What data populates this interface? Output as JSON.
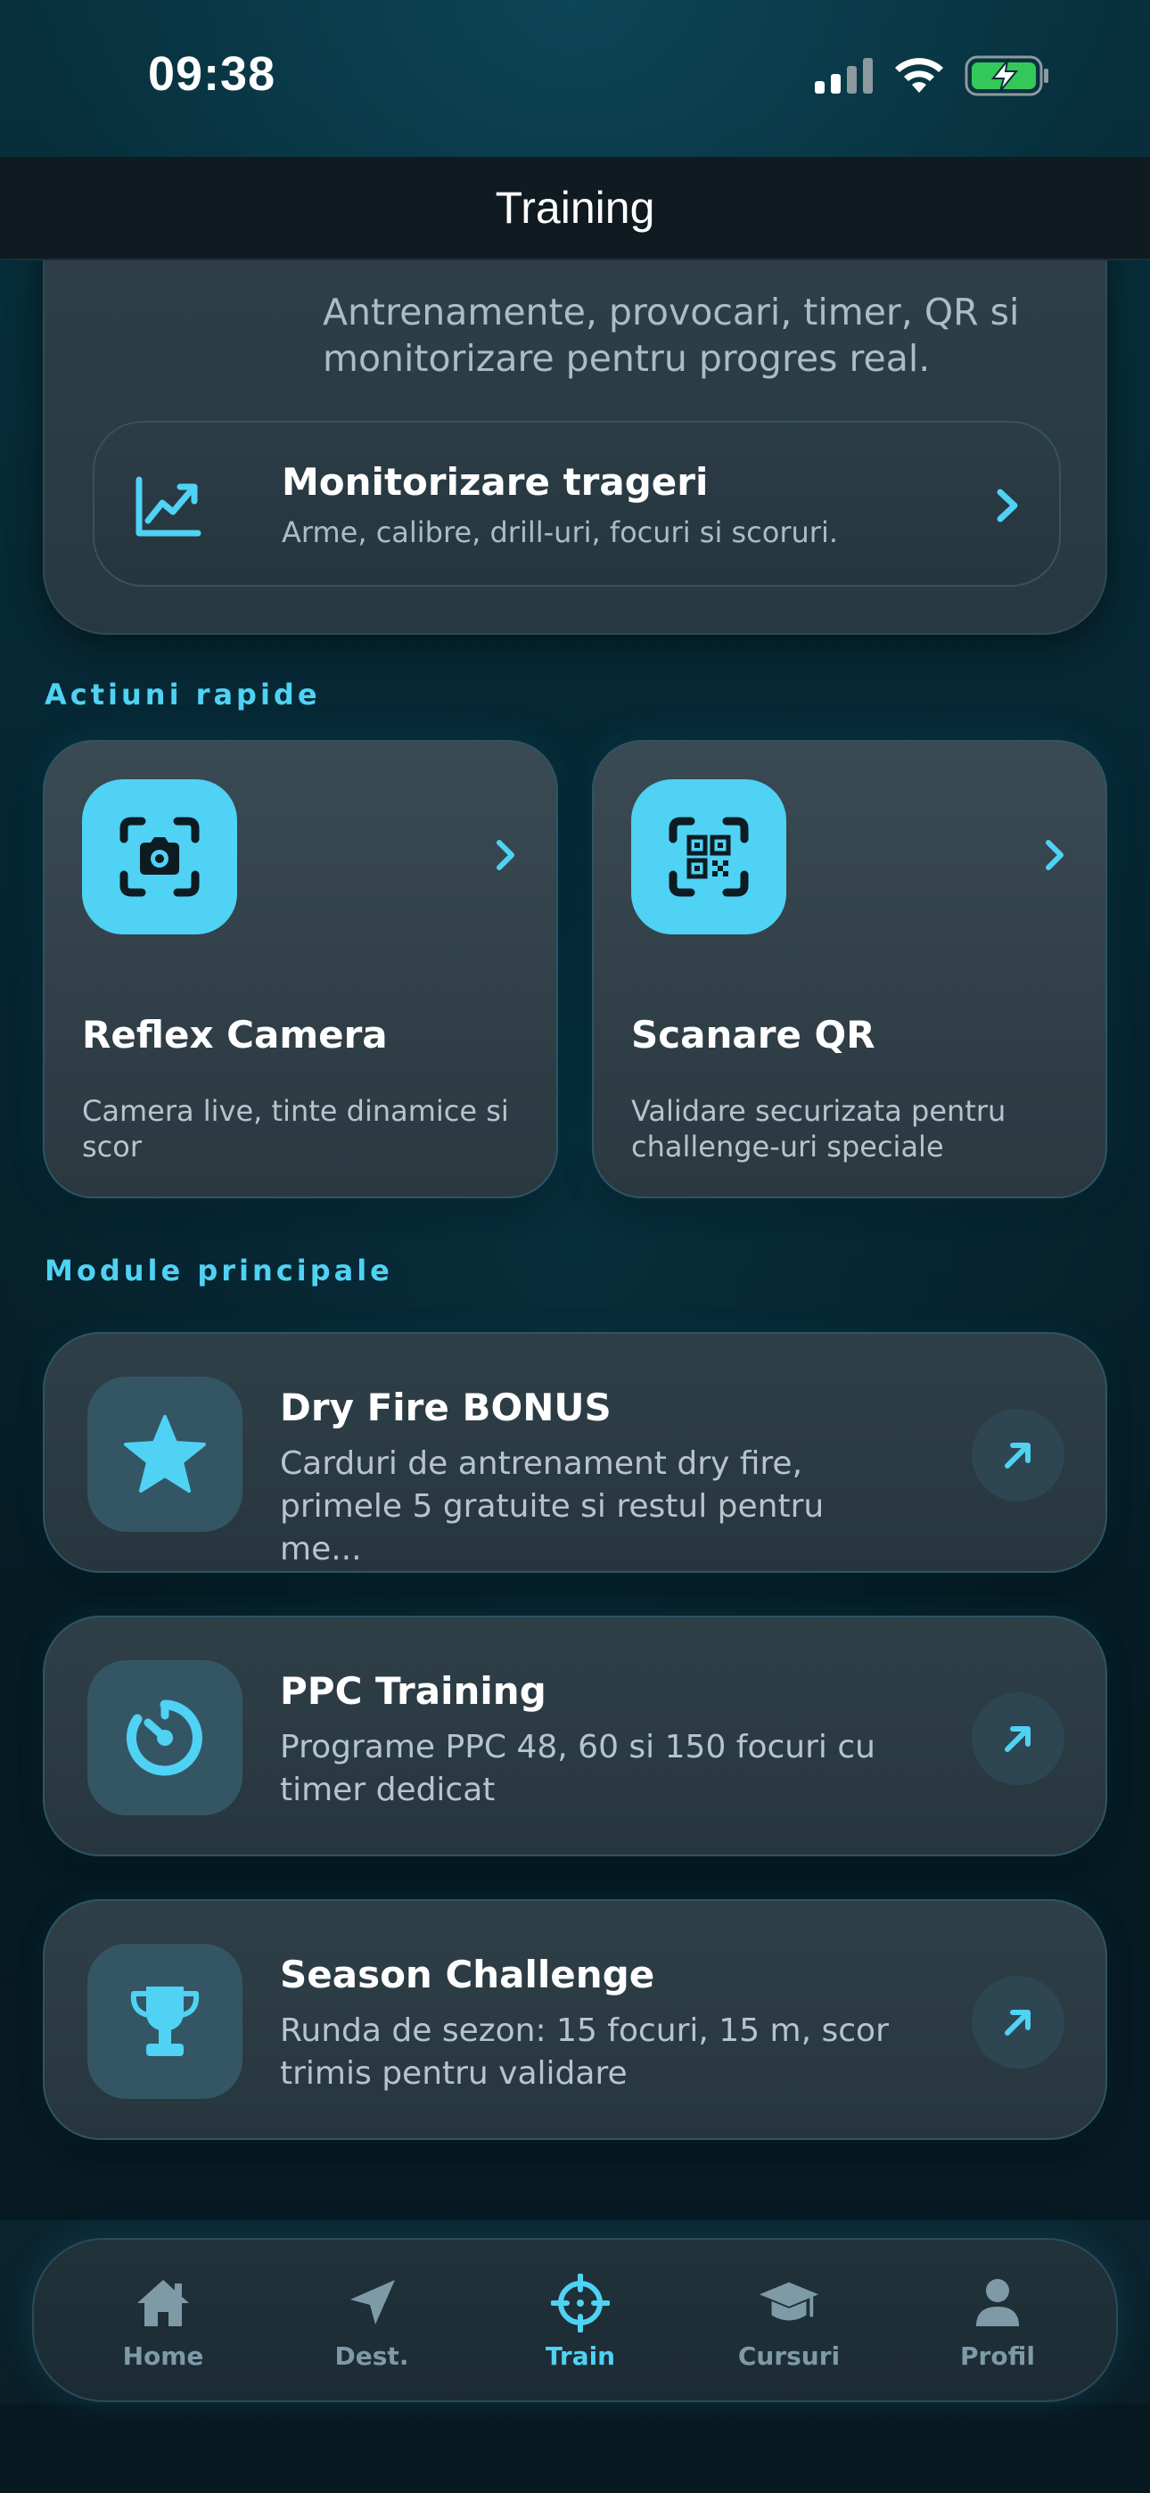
{
  "status_bar": {
    "time": "09:38"
  },
  "nav": {
    "title": "Training"
  },
  "hero": {
    "subtitle": "Antrenamente, provocari, timer, QR si monitorizare pentru progres real.",
    "monitor": {
      "title": "Monitorizare trageri",
      "description": "Arme, calibre, drill-uri, focuri si scoruri.",
      "icon": "chart-line-icon"
    }
  },
  "quick_actions": {
    "title": "Actiuni rapide",
    "items": [
      {
        "title": "Reflex Camera",
        "description": "Camera live, tinte dinamice si scor",
        "icon": "camera-scan-icon"
      },
      {
        "title": "Scanare QR",
        "description": "Validare securizata pentru challenge-uri speciale",
        "icon": "qr-scan-icon"
      }
    ]
  },
  "modules": {
    "title": "Module principale",
    "items": [
      {
        "title": "Dry Fire BONUS",
        "description": "Carduri de antrenament dry fire, primele 5 gratuite si restul pentru me...",
        "icon": "star-icon"
      },
      {
        "title": "PPC Training",
        "description": "Programe PPC 48, 60 si 150 focuri cu timer dedicat",
        "icon": "timer-icon"
      },
      {
        "title": "Season Challenge",
        "description": "Runda de sezon: 15 focuri, 15 m, scor trimis pentru validare",
        "icon": "trophy-icon"
      }
    ]
  },
  "tabs": [
    {
      "label": "Home",
      "icon": "home-icon",
      "active": false
    },
    {
      "label": "Dest.",
      "icon": "navigation-arrow-icon",
      "active": false
    },
    {
      "label": "Train",
      "icon": "crosshair-icon",
      "active": true
    },
    {
      "label": "Cursuri",
      "icon": "graduation-cap-icon",
      "active": false
    },
    {
      "label": "Profil",
      "icon": "person-icon",
      "active": false
    }
  ],
  "colors": {
    "accent": "#4fd2f4",
    "battery": "#34c759",
    "tab_inactive": "#7e9aa7"
  }
}
